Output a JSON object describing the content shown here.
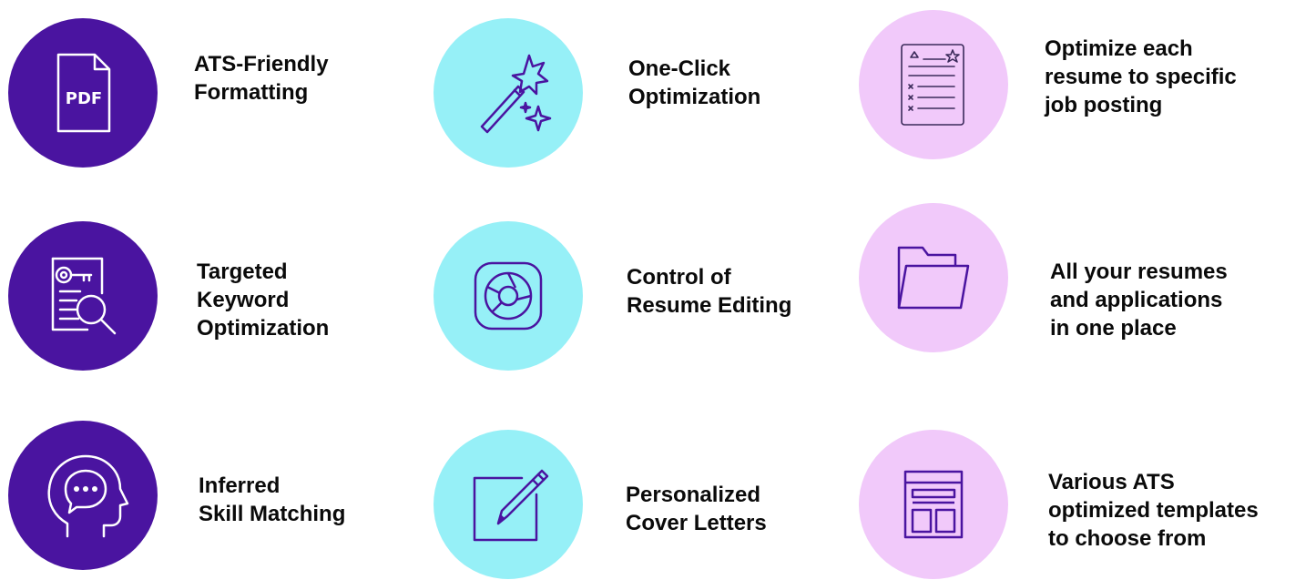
{
  "colors": {
    "purple": "#4A14A0",
    "cyan": "#96F0F7",
    "pink": "#F1C9FA",
    "text": "#0a0a0a"
  },
  "features": [
    {
      "icon": "pdf-file-icon",
      "lines": [
        "ATS-Friendly",
        "Formatting"
      ]
    },
    {
      "icon": "magic-wand-icon",
      "lines": [
        "One-Click",
        "Optimization"
      ]
    },
    {
      "icon": "job-posting-icon",
      "lines": [
        "Optimize each",
        "resume to specific",
        "job posting"
      ]
    },
    {
      "icon": "keyword-search-icon",
      "lines": [
        "Targeted",
        "Keyword",
        "Optimization"
      ]
    },
    {
      "icon": "aperture-edit-icon",
      "lines": [
        "Control of",
        "Resume Editing"
      ]
    },
    {
      "icon": "folder-icon",
      "lines": [
        "All your resumes",
        "and applications",
        "in one place"
      ]
    },
    {
      "icon": "head-chat-icon",
      "lines": [
        "Inferred",
        "Skill Matching"
      ]
    },
    {
      "icon": "pencil-square-icon",
      "lines": [
        "Personalized",
        "Cover Letters"
      ]
    },
    {
      "icon": "template-layout-icon",
      "lines": [
        "Various ATS",
        "optimized templates",
        "to choose from"
      ]
    }
  ],
  "icons": {
    "pdf_text": "PDF"
  }
}
